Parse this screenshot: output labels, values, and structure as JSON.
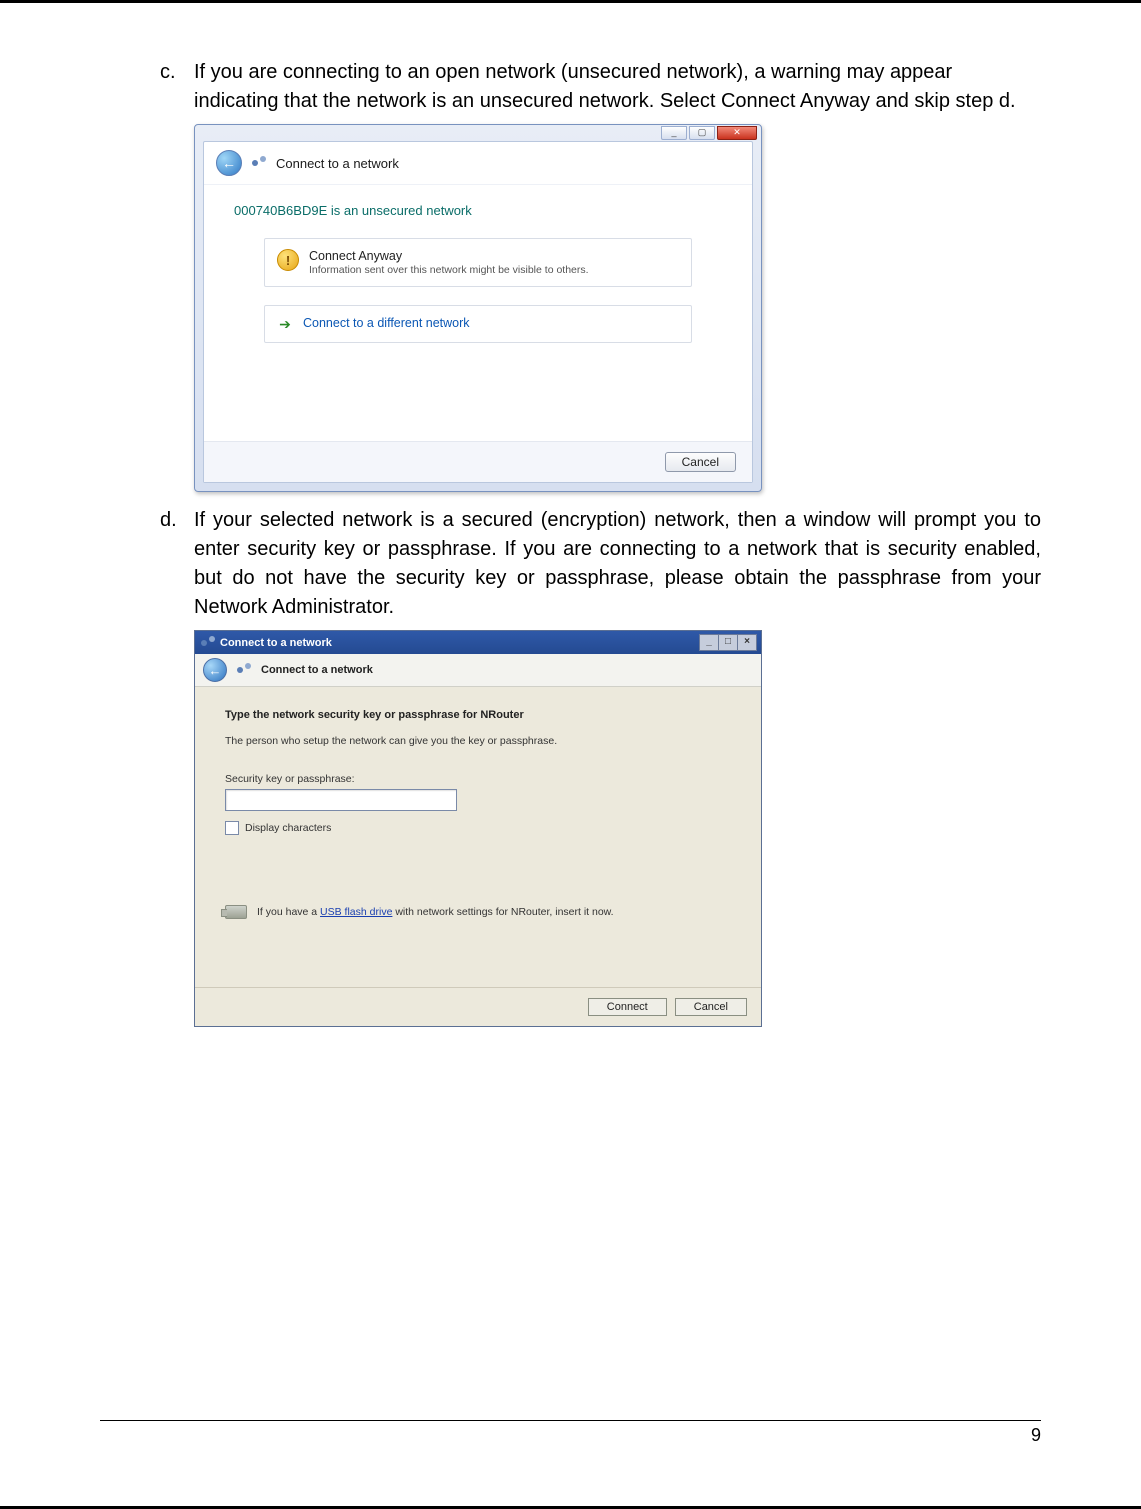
{
  "list": {
    "c": {
      "marker": "c.",
      "text": "If you are connecting to an open network (unsecured network), a warning may appear indicating that the network is an unsecured network.  Select Connect Anyway and skip step d."
    },
    "d": {
      "marker": "d.",
      "text": "If your selected network is a secured (encryption) network, then a window will prompt you to enter security key or passphrase.  If you are connecting to a network that is security enabled, but do not have the security key or passphrase, please obtain the passphrase from your Network Administrator."
    }
  },
  "shot1": {
    "window_title": "Connect to a network",
    "message": "000740B6BD9E is an unsecured network",
    "opt1_title": "Connect Anyway",
    "opt1_sub": "Information sent over this network might be visible to others.",
    "opt2_title": "Connect to a different network",
    "cancel": "Cancel",
    "win_min": "_",
    "win_max": "▢",
    "win_close": "✕"
  },
  "shot2": {
    "titlebar": "Connect to a network",
    "nav_title": "Connect to a network",
    "heading": "Type the network security key or passphrase for NRouter",
    "subtext": "The person who setup the network can give you the key or passphrase.",
    "field_label": "Security key or passphrase:",
    "checkbox_label": "Display characters",
    "usb_prefix": "If you have a ",
    "usb_link": "USB flash drive",
    "usb_suffix": " with network settings for NRouter, insert it now.",
    "connect": "Connect",
    "cancel": "Cancel",
    "tb_min": "_",
    "tb_max": "□",
    "tb_close": "×"
  },
  "page_number": "9"
}
